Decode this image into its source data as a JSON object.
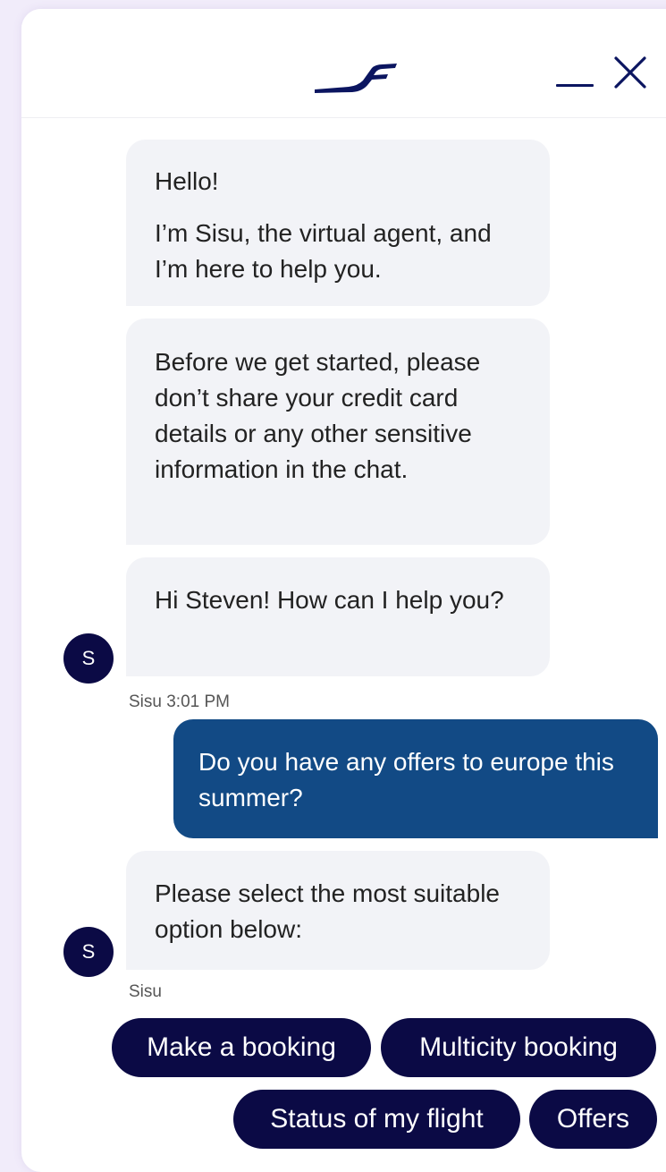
{
  "header": {
    "logo_icon": "finnair-logo-icon",
    "minimize_icon": "minimize-icon",
    "close_icon": "close-icon",
    "brand_color": "#0b1560"
  },
  "messages": [
    {
      "sender": "bot",
      "lines": [
        "Hello!",
        "I’m Sisu, the virtual agent, and I’m here to help you."
      ]
    },
    {
      "sender": "bot",
      "text": "Before we get started, please don’t share your credit card details or any other sensitive information in the chat."
    },
    {
      "sender": "bot",
      "text": "Hi Steven! How can I help you?",
      "avatar": "S",
      "meta": "Sisu 3:01 PM"
    },
    {
      "sender": "user",
      "text": "Do you have any offers to europe this summer?"
    },
    {
      "sender": "bot",
      "text": "Please select the most suitable option below:",
      "avatar": "S",
      "meta": "Sisu"
    }
  ],
  "quick_replies": [
    "Make a booking",
    "Multicity booking",
    "Status of my flight",
    "Offers"
  ],
  "colors": {
    "bot_bubble": "#f2f3f7",
    "user_bubble": "#124a85",
    "chip": "#0b0a45",
    "avatar": "#0b0a45"
  }
}
